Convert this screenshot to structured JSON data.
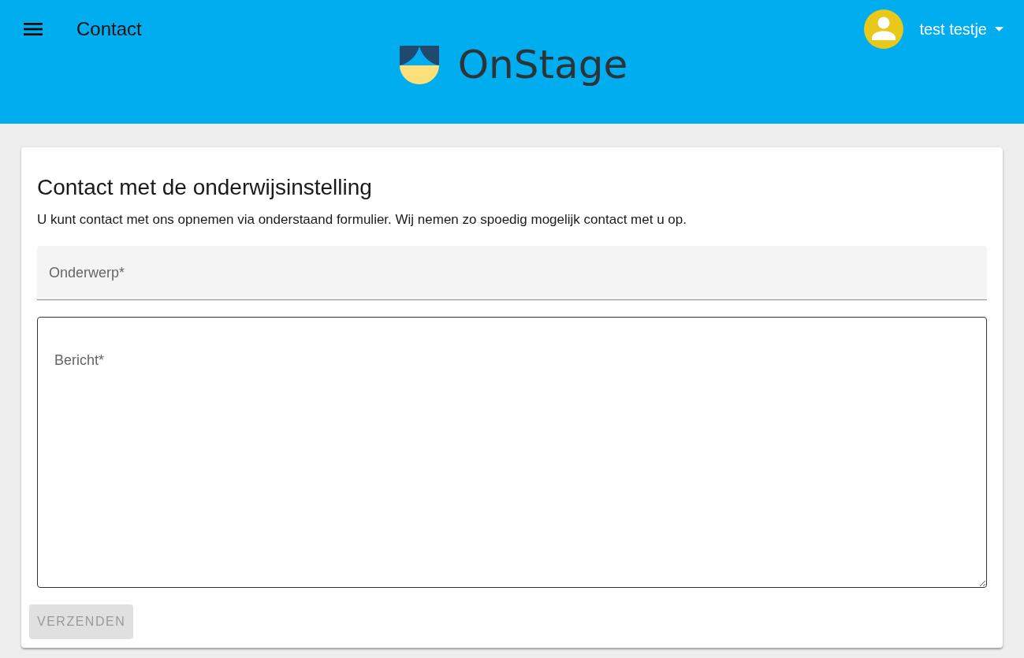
{
  "app_bar": {
    "title": "Contact",
    "logo_text": "OnStage",
    "user": {
      "name": "test testje"
    }
  },
  "card": {
    "title": "Contact met de onderwijsinstelling",
    "description": "U kunt contact met ons opnemen via onderstaand formulier. Wij nemen zo spoedig mogelijk contact met u op.",
    "fields": [
      {
        "kind": "filled",
        "placeholder": "Onderwerp*"
      },
      {
        "kind": "textarea",
        "placeholder": "Bericht*"
      }
    ],
    "submit": {
      "label": "VERZENDEN",
      "disabled": true
    }
  }
}
